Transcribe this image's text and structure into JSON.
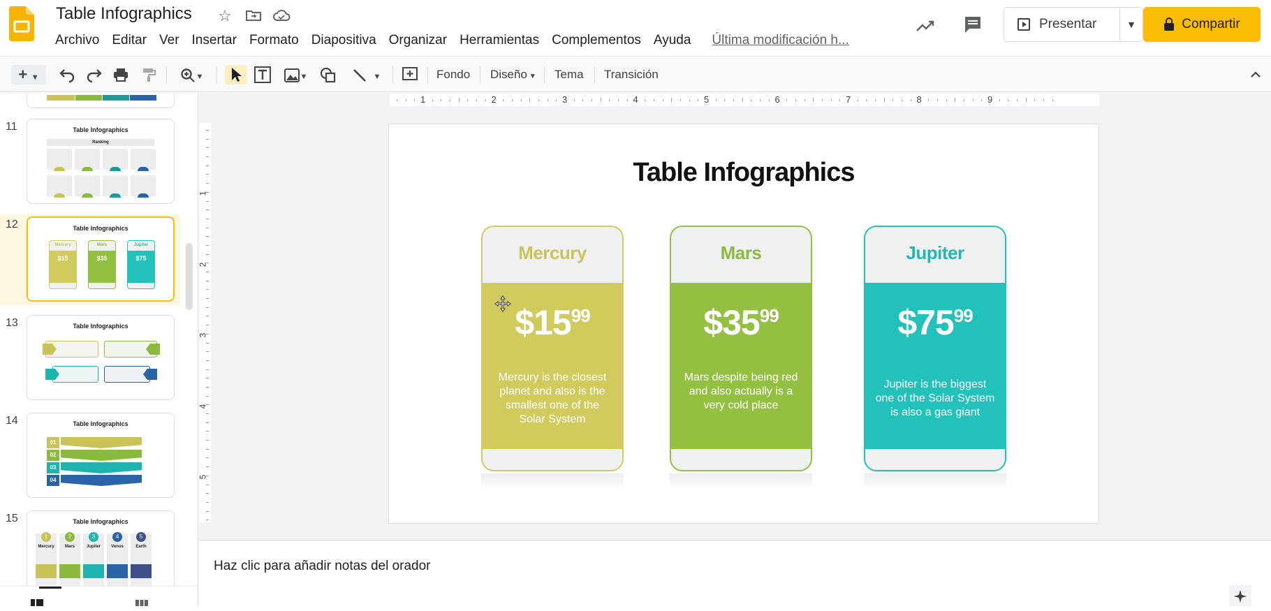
{
  "header": {
    "doc_title": "Table Infographics",
    "icons": [
      "star-icon",
      "move-to-folder-icon",
      "cloud-saved-icon"
    ],
    "menu": [
      "Archivo",
      "Editar",
      "Ver",
      "Insertar",
      "Formato",
      "Diapositiva",
      "Organizar",
      "Herramientas",
      "Complementos",
      "Ayuda"
    ],
    "last_edit": "Última modificación h...",
    "present_label": "Presentar",
    "share_label": "Compartir"
  },
  "toolbar": {
    "background_label": "Fondo",
    "layout_label": "Diseño",
    "theme_label": "Tema",
    "transition_label": "Transición"
  },
  "filmstrip": {
    "slides": [
      {
        "number": "11",
        "title": "Table Infographics",
        "subtitle": "Ranking"
      },
      {
        "number": "12",
        "title": "Table Infographics",
        "selected": true
      },
      {
        "number": "13",
        "title": "Table Infographics"
      },
      {
        "number": "14",
        "title": "Table Infographics"
      },
      {
        "number": "15",
        "title": "Table Infographics"
      }
    ],
    "thumb14_numbers": [
      "01",
      "02",
      "03",
      "04"
    ],
    "thumb15_numbers": [
      "1",
      "2",
      "3",
      "4",
      "5"
    ],
    "thumb15_names": [
      "Mercury",
      "Mars",
      "Jupiter",
      "Venus",
      "Earth"
    ],
    "thumb12_names": [
      "Mercury",
      "Mars",
      "Jupiter"
    ],
    "thumb12_prices": [
      "$15",
      "$35",
      "$75"
    ]
  },
  "ruler": {
    "top_labels": [
      "1",
      "2",
      "3",
      "4",
      "5",
      "6",
      "7",
      "8",
      "9"
    ],
    "left_labels": [
      "1",
      "2",
      "3",
      "4",
      "5"
    ]
  },
  "slide": {
    "title": "Table Infographics",
    "cards": [
      {
        "name": "Mercury",
        "price": "$15",
        "cents": "99",
        "desc": "Mercury is the closest planet and also is the smallest one of the Solar System",
        "color": "#d1cb5e",
        "name_color": "#c9c35a"
      },
      {
        "name": "Mars",
        "price": "$35",
        "cents": "99",
        "desc": "Mars despite being red and also actually is a very cold place",
        "color": "#94c042",
        "name_color": "#8cba3f"
      },
      {
        "name": "Jupiter",
        "price": "$75",
        "cents": "99",
        "desc": "Jupiter is the biggest one of the Solar System is also a gas giant",
        "color": "#22c2bb",
        "name_color": "#22b7b1"
      }
    ]
  },
  "notes": {
    "placeholder": "Haz clic para añadir notas del orador"
  }
}
